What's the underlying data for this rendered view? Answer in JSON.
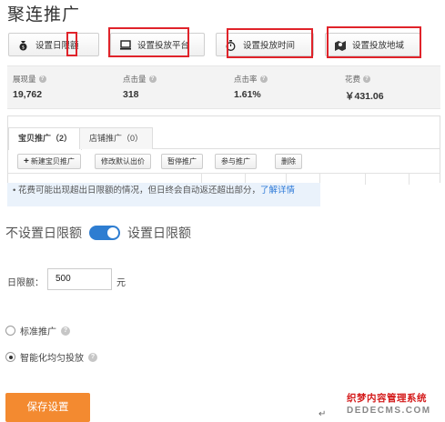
{
  "title": "聚连推广",
  "toolbar": {
    "buttons": [
      {
        "label": "设置日限额",
        "icon": "money-bag-icon"
      },
      {
        "label": "设置投放平台",
        "icon": "monitor-icon"
      },
      {
        "label": "设置投放时间",
        "icon": "stopwatch-icon"
      },
      {
        "label": "设置投放地域",
        "icon": "map-pin-icon"
      }
    ]
  },
  "stats": [
    {
      "label": "展现量",
      "value": "19,762"
    },
    {
      "label": "点击量",
      "value": "318"
    },
    {
      "label": "点击率",
      "value": "1.61%"
    },
    {
      "label": "花费",
      "value": "￥431.06"
    }
  ],
  "tabs": [
    {
      "label": "宝贝推广（2）",
      "active": true
    },
    {
      "label": "店铺推广（0）",
      "active": false
    }
  ],
  "actions": [
    "新建宝贝推广",
    "修改默认出价",
    "暂停推广",
    "参与推广",
    "删除"
  ],
  "notice": {
    "text": "• 花费可能出现超出日限额的情况，但日终会自动返还超出部分，",
    "link": "了解详情"
  },
  "limit": {
    "off_label": "不设置日限额",
    "on_label": "设置日限额",
    "enabled": true
  },
  "daily": {
    "label": "日限额：",
    "value": "500",
    "unit": "元"
  },
  "options": [
    {
      "label": "标准推广",
      "selected": false
    },
    {
      "label": "智能化均匀投放",
      "selected": true
    }
  ],
  "save_label": "保存设置",
  "watermark": {
    "line1": "织梦内容管理系统",
    "line2": "DEDECMS.COM"
  },
  "colors": {
    "accent_blue": "#2e7dd1",
    "save_orange": "#f38a30",
    "highlight_red": "#e0232a"
  }
}
